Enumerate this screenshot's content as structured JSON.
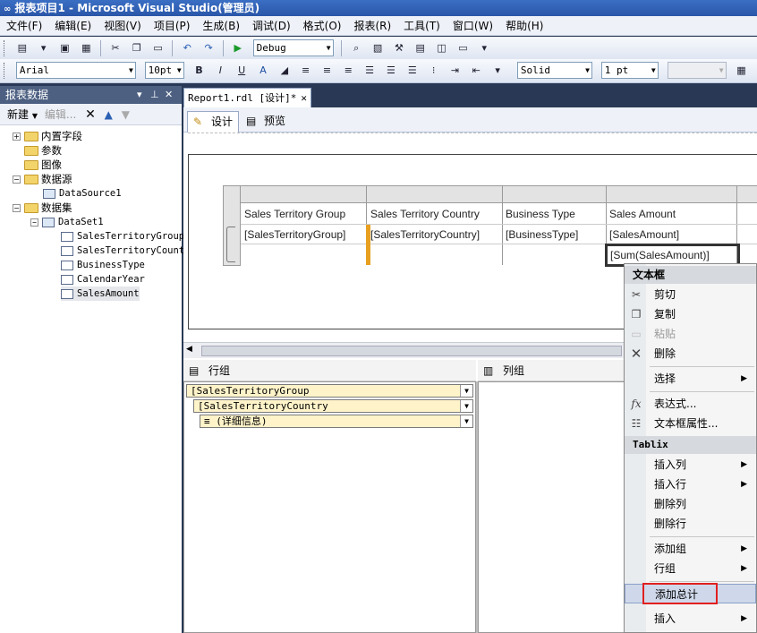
{
  "window": {
    "title": "报表项目1 - Microsoft Visual Studio(管理员)"
  },
  "menubar": [
    "文件(F)",
    "编辑(E)",
    "视图(V)",
    "项目(P)",
    "生成(B)",
    "调试(D)",
    "格式(O)",
    "报表(R)",
    "工具(T)",
    "窗口(W)",
    "帮助(H)"
  ],
  "toolbar1": {
    "config": "Debug"
  },
  "toolbar2": {
    "font": "Arial",
    "size": "10pt",
    "border_style": "Solid",
    "border_width": "1 pt"
  },
  "report_data": {
    "title": "报表数据",
    "new_label": "新建",
    "edit_label": "编辑...",
    "tree": {
      "builtin": "内置字段",
      "params": "参数",
      "images": "图像",
      "datasources": "数据源",
      "datasource1": "DataSource1",
      "datasets": "数据集",
      "dataset1": "DataSet1",
      "fields": [
        "SalesTerritoryGroup",
        "SalesTerritoryCountry",
        "BusinessType",
        "CalendarYear",
        "SalesAmount"
      ]
    }
  },
  "doc": {
    "tab_label": "Report1.rdl [设计]*",
    "design_tab": "设计",
    "preview_tab": "预览"
  },
  "tablix": {
    "headers": [
      "Sales Territory Group",
      "Sales Territory Country",
      "Business Type",
      "Sales Amount"
    ],
    "details": [
      "[SalesTerritoryGroup]",
      "[SalesTerritoryCountry]",
      "[BusinessType]",
      "[SalesAmount]"
    ],
    "total": "[Sum(SalesAmount)]"
  },
  "groups": {
    "row_title": "行组",
    "col_title": "列组",
    "row_groups": [
      "SalesTerritoryGroup",
      "SalesTerritoryCountry",
      "(详细信息)"
    ]
  },
  "context_menu": {
    "section1": "文本框",
    "cut": "剪切",
    "copy": "复制",
    "paste": "粘贴",
    "delete": "删除",
    "select": "选择",
    "expression": "表达式...",
    "props": "文本框属性...",
    "section2": "Tablix",
    "insert_col": "插入列",
    "insert_row": "插入行",
    "delete_col": "删除列",
    "delete_row": "删除行",
    "add_group": "添加组",
    "row_group": "行组",
    "add_total": "添加总计",
    "insert": "插入"
  }
}
